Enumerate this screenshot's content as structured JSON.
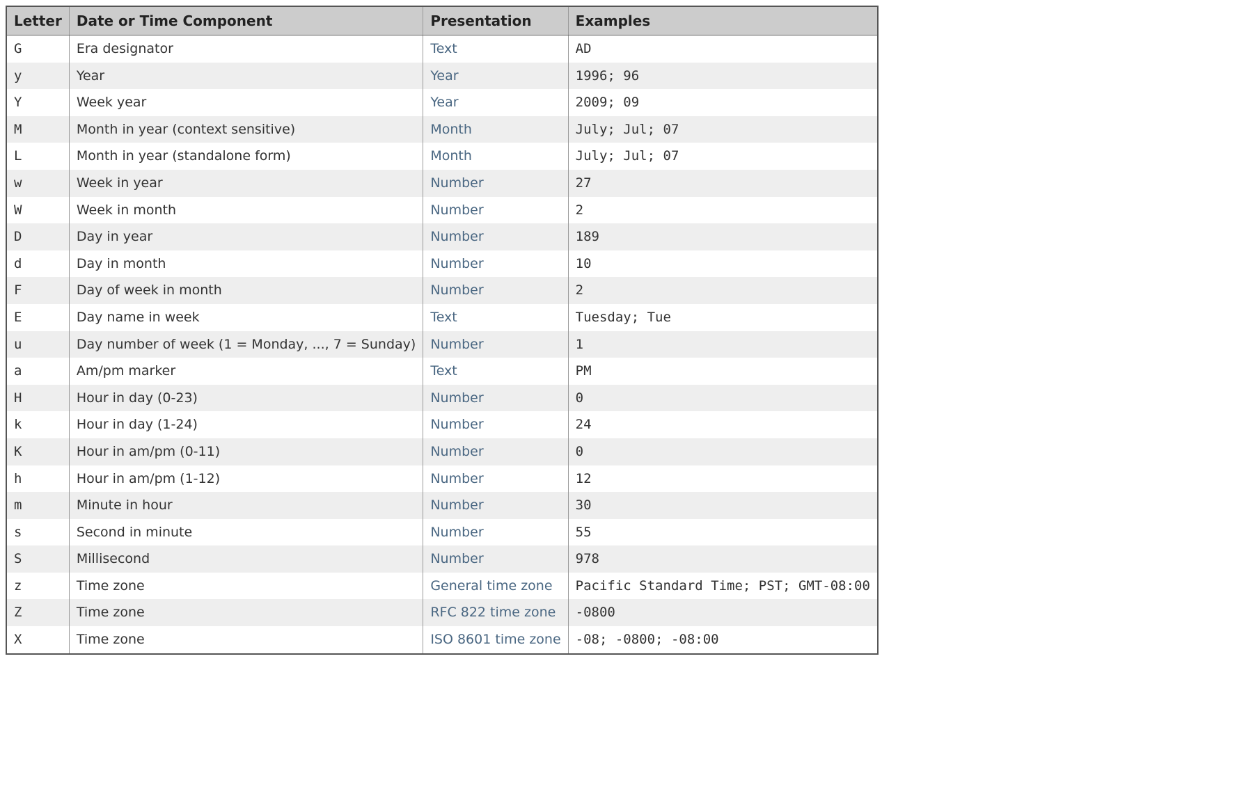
{
  "headers": {
    "letter": "Letter",
    "component": "Date or Time Component",
    "presentation": "Presentation",
    "examples": "Examples"
  },
  "rows": [
    {
      "letter": "G",
      "component": "Era designator",
      "presentation": "Text",
      "examples": "AD"
    },
    {
      "letter": "y",
      "component": "Year",
      "presentation": "Year",
      "examples": "1996; 96"
    },
    {
      "letter": "Y",
      "component": "Week year",
      "presentation": "Year",
      "examples": "2009; 09"
    },
    {
      "letter": "M",
      "component": "Month in year (context sensitive)",
      "presentation": "Month",
      "examples": "July; Jul; 07"
    },
    {
      "letter": "L",
      "component": "Month in year (standalone form)",
      "presentation": "Month",
      "examples": "July; Jul; 07"
    },
    {
      "letter": "w",
      "component": "Week in year",
      "presentation": "Number",
      "examples": "27"
    },
    {
      "letter": "W",
      "component": "Week in month",
      "presentation": "Number",
      "examples": "2"
    },
    {
      "letter": "D",
      "component": "Day in year",
      "presentation": "Number",
      "examples": "189"
    },
    {
      "letter": "d",
      "component": "Day in month",
      "presentation": "Number",
      "examples": "10"
    },
    {
      "letter": "F",
      "component": "Day of week in month",
      "presentation": "Number",
      "examples": "2"
    },
    {
      "letter": "E",
      "component": "Day name in week",
      "presentation": "Text",
      "examples": "Tuesday; Tue"
    },
    {
      "letter": "u",
      "component": "Day number of week (1 = Monday, ..., 7 = Sunday)",
      "presentation": "Number",
      "examples": "1"
    },
    {
      "letter": "a",
      "component": "Am/pm marker",
      "presentation": "Text",
      "examples": "PM"
    },
    {
      "letter": "H",
      "component": "Hour in day (0-23)",
      "presentation": "Number",
      "examples": "0"
    },
    {
      "letter": "k",
      "component": "Hour in day (1-24)",
      "presentation": "Number",
      "examples": "24"
    },
    {
      "letter": "K",
      "component": "Hour in am/pm (0-11)",
      "presentation": "Number",
      "examples": "0"
    },
    {
      "letter": "h",
      "component": "Hour in am/pm (1-12)",
      "presentation": "Number",
      "examples": "12"
    },
    {
      "letter": "m",
      "component": "Minute in hour",
      "presentation": "Number",
      "examples": "30"
    },
    {
      "letter": "s",
      "component": "Second in minute",
      "presentation": "Number",
      "examples": "55"
    },
    {
      "letter": "S",
      "component": "Millisecond",
      "presentation": "Number",
      "examples": "978"
    },
    {
      "letter": "z",
      "component": "Time zone",
      "presentation": "General time zone",
      "examples": "Pacific Standard Time; PST; GMT-08:00"
    },
    {
      "letter": "Z",
      "component": "Time zone",
      "presentation": "RFC 822 time zone",
      "examples": "-0800"
    },
    {
      "letter": "X",
      "component": "Time zone",
      "presentation": "ISO 8601 time zone",
      "examples": "-08; -0800; -08:00"
    }
  ]
}
